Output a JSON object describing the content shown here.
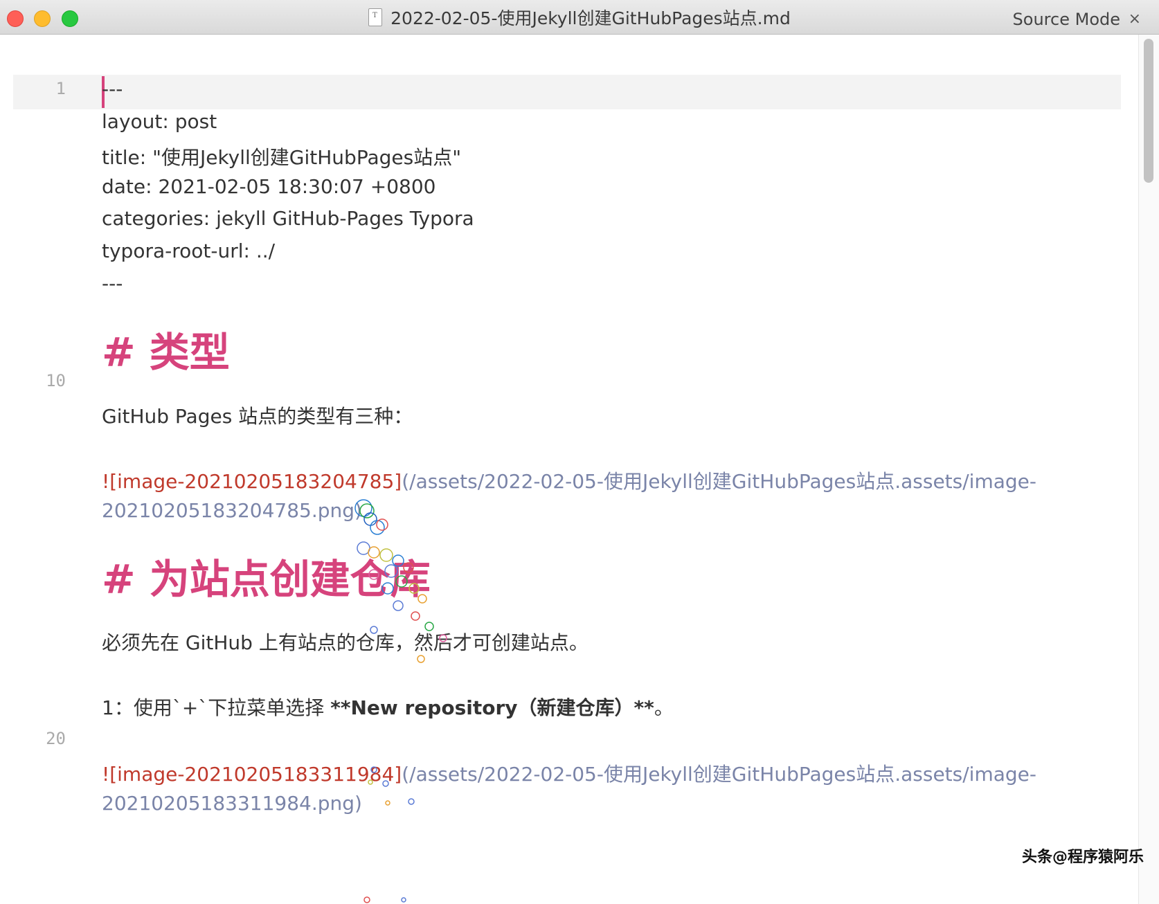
{
  "window": {
    "title": "2022-02-05-使用Jekyll创建GitHubPages站点.md",
    "mode": "Source Mode",
    "mode_close": "×"
  },
  "gutter": {
    "line_1": "1",
    "line_10": "10",
    "line_20": "20"
  },
  "editor": {
    "front_matter_open": "---",
    "layout": "layout: post",
    "title": "title:  \"使用Jekyll创建GitHubPages站点\"",
    "date": "date:   2021-02-05 18:30:07 +0800",
    "categories": "categories: jekyll GitHub-Pages Typora",
    "typora_root": "typora-root-url: ../",
    "front_matter_close": "---",
    "heading_1": "# 类型",
    "paragraph_1": "GitHub Pages 站点的类型有三种：",
    "image_1_alt": "![image-20210205183204785]",
    "image_1_url_a": "(/assets/2022-02-05-使用Jekyll创建GitHubPages站点.assets/image-",
    "image_1_url_b": "20210205183204785.png)",
    "heading_2": "# 为站点创建仓库",
    "paragraph_2": "必须先在 GitHub 上有站点的仓库，然后才可创建站点。",
    "step_1_prefix": "1：使用`+`下拉菜单选择 ",
    "step_1_bold": "**New repository（新建仓库）**",
    "step_1_suffix": "。",
    "image_2_alt": "![image-20210205183311984]",
    "image_2_url_a": "(/assets/2022-02-05-使用Jekyll创建GitHubPages站点.assets/image-",
    "image_2_url_b": "20210205183311984.png)"
  },
  "watermark": "头条@程序猿阿乐",
  "colors": {
    "heading": "#d6437c",
    "image_alt": "#c0392b",
    "image_url": "#7a84a8"
  }
}
